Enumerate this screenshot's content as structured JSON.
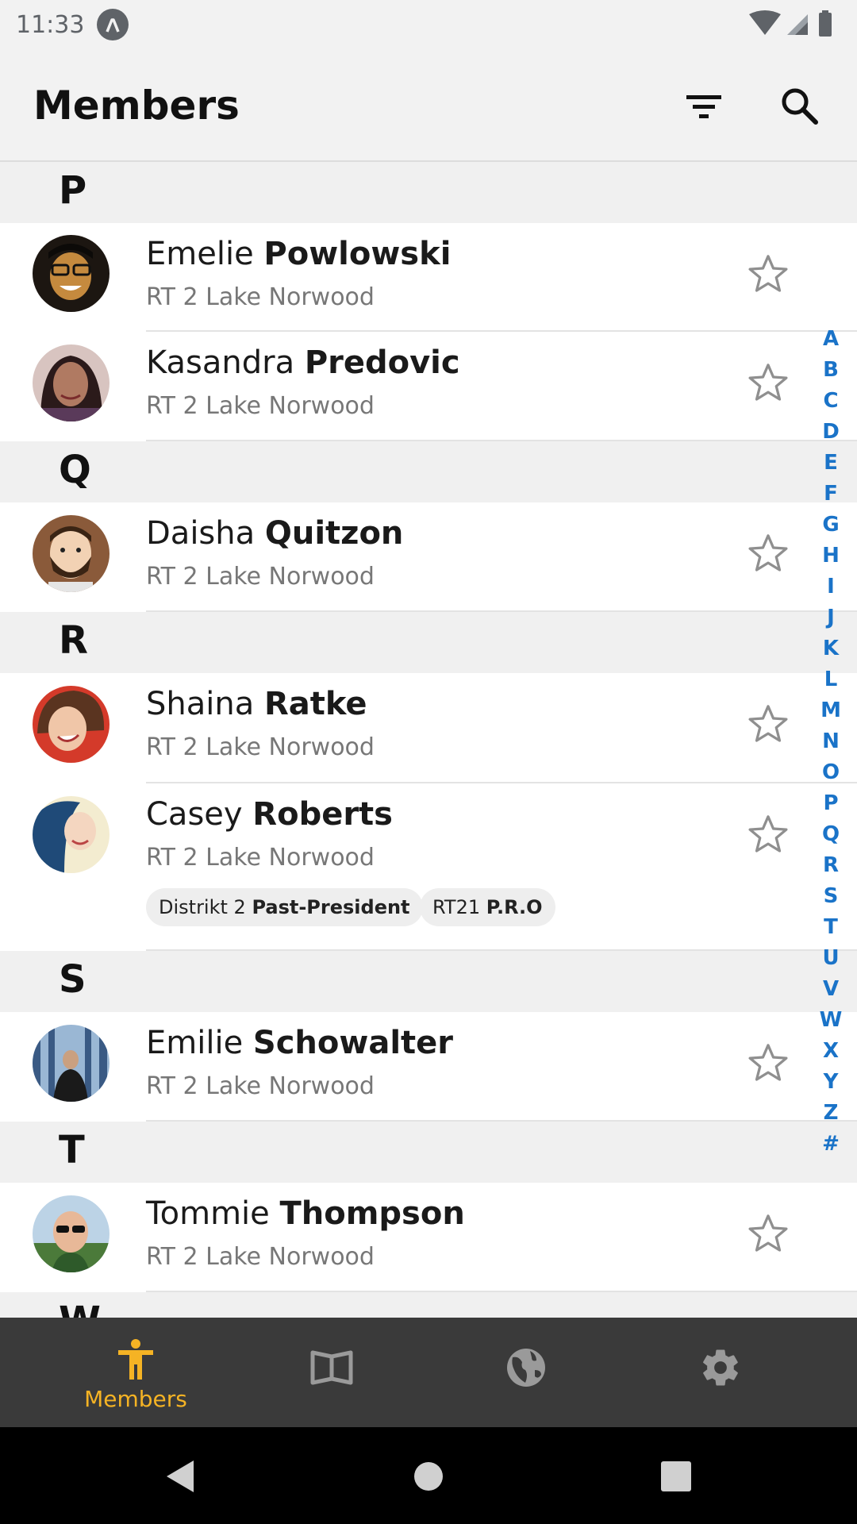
{
  "status_bar": {
    "time": "11:33",
    "app_icon": "app-lambda-icon",
    "icons": [
      "wifi-icon",
      "signal-icon",
      "battery-icon"
    ]
  },
  "header": {
    "title": "Members",
    "actions": [
      "filter-icon",
      "search-icon"
    ]
  },
  "sections": [
    {
      "letter": "P"
    },
    {
      "letter": "Q"
    },
    {
      "letter": "R"
    },
    {
      "letter": "S"
    },
    {
      "letter": "T"
    },
    {
      "letter": "W"
    }
  ],
  "members": [
    {
      "first": "Emelie",
      "last": "Powlowski",
      "subtitle": "RT 2 Lake Norwood",
      "starred": false
    },
    {
      "first": "Kasandra",
      "last": "Predovic",
      "subtitle": "RT 2 Lake Norwood",
      "starred": false
    },
    {
      "first": "Daisha",
      "last": "Quitzon",
      "subtitle": "RT 2 Lake Norwood",
      "starred": false
    },
    {
      "first": "Shaina",
      "last": "Ratke",
      "subtitle": "RT 2 Lake Norwood",
      "starred": false
    },
    {
      "first": "Casey",
      "last": "Roberts",
      "subtitle": "RT 2 Lake Norwood",
      "starred": false,
      "chips": [
        {
          "prefix": "Distrikt 2 ",
          "role": "Past-President"
        },
        {
          "prefix": "RT21 ",
          "role": "P.R.O"
        }
      ]
    },
    {
      "first": "Emilie",
      "last": "Schowalter",
      "subtitle": "RT 2 Lake Norwood",
      "starred": false
    },
    {
      "first": "Tommie",
      "last": "Thompson",
      "subtitle": "RT 2 Lake Norwood",
      "starred": false
    }
  ],
  "alphabet": [
    "A",
    "B",
    "C",
    "D",
    "E",
    "F",
    "G",
    "H",
    "I",
    "J",
    "K",
    "L",
    "M",
    "N",
    "O",
    "P",
    "Q",
    "R",
    "S",
    "T",
    "U",
    "V",
    "W",
    "X",
    "Y",
    "Z",
    "#"
  ],
  "bottom_nav": [
    {
      "icon": "person-icon",
      "label": "Members",
      "active": true
    },
    {
      "icon": "book-icon",
      "label": "",
      "active": false
    },
    {
      "icon": "globe-icon",
      "label": "",
      "active": false
    },
    {
      "icon": "gear-icon",
      "label": "",
      "active": false
    }
  ],
  "colors": {
    "accent": "#f5b324",
    "index": "#1a73c8",
    "nav_bg": "#3a3a3a",
    "header_bg": "#f2f2f2"
  }
}
